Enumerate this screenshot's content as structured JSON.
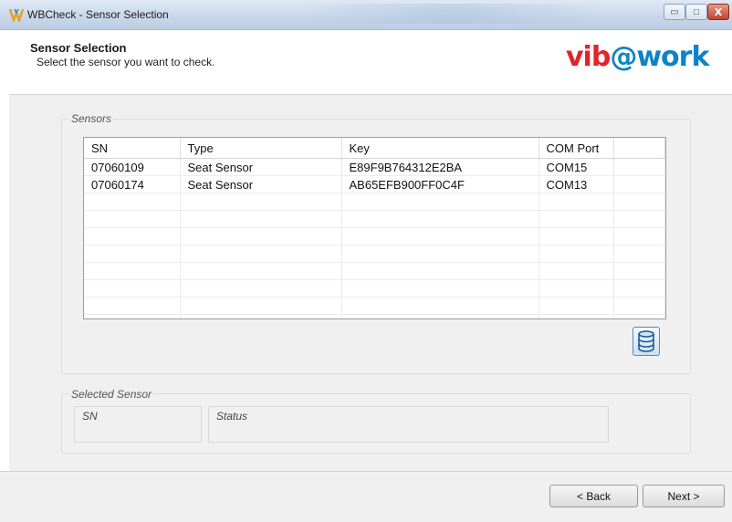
{
  "window": {
    "title": "WBCheck - Sensor Selection",
    "controls": {
      "minimize": "▭",
      "maximize": "□",
      "close": "X"
    }
  },
  "header": {
    "title": "Sensor Selection",
    "subtitle": "Select the sensor you want to check.",
    "logo": {
      "vib": "vib",
      "at": "@",
      "work": "work"
    }
  },
  "sensors": {
    "legend": "Sensors",
    "columns": [
      "SN",
      "Type",
      "Key",
      "COM Port"
    ],
    "rows": [
      [
        "07060109",
        "Seat Sensor",
        "E89F9B764312E2BA",
        "COM15"
      ],
      [
        "07060174",
        "Seat Sensor",
        "AB65EFB900FF0C4F",
        "COM13"
      ]
    ]
  },
  "selected": {
    "legend": "Selected Sensor",
    "sn_label": "SN",
    "status_label": "Status"
  },
  "footer": {
    "back_label": "< Back",
    "next_label": "Next >"
  },
  "colors": {
    "logo_red": "#e2232a",
    "logo_blue": "#0c84c6"
  }
}
